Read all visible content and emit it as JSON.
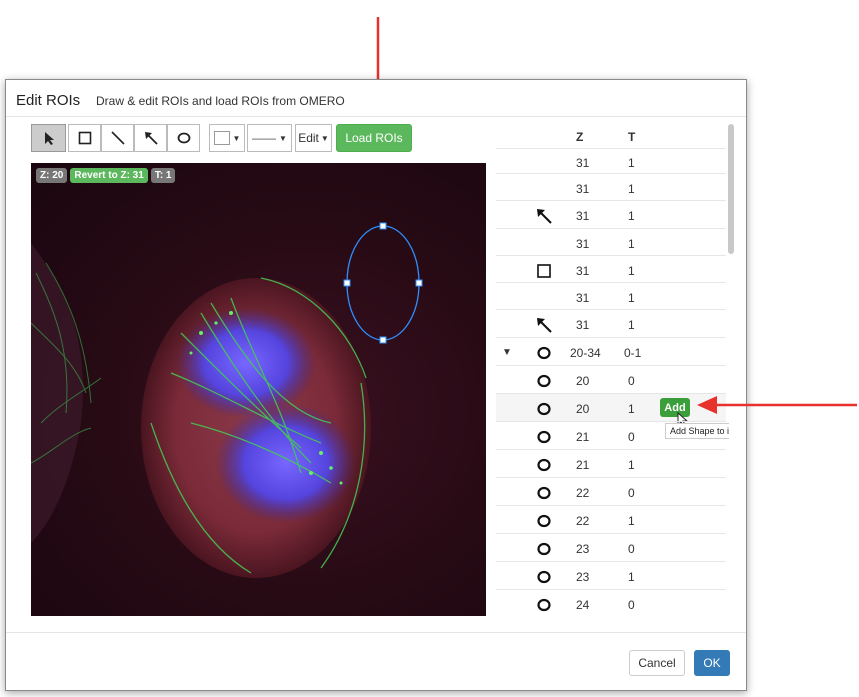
{
  "dialog": {
    "title": "Edit ROIs",
    "subtitle": "Draw & edit ROIs and load ROIs from OMERO"
  },
  "toolbar": {
    "tools": [
      "select-tool-icon",
      "rectangle-tool-icon",
      "line-tool-icon",
      "arrow-tool-icon",
      "ellipse-tool-icon"
    ],
    "line_style": "——",
    "edit_label": "Edit",
    "load_label": "Load ROIs"
  },
  "viewer": {
    "z_badge": "Z: 20",
    "revert_badge": "Revert to Z: 31",
    "t_badge": "T: 1"
  },
  "table": {
    "col_z": "Z",
    "col_t": "T",
    "rows": [
      {
        "icon": "",
        "z": "31",
        "t": "1"
      },
      {
        "icon": "",
        "z": "31",
        "t": "1"
      },
      {
        "icon": "arrow-icon",
        "z": "31",
        "t": "1"
      },
      {
        "icon": "",
        "z": "31",
        "t": "1"
      },
      {
        "icon": "rectangle-icon",
        "z": "31",
        "t": "1"
      },
      {
        "icon": "",
        "z": "31",
        "t": "1"
      },
      {
        "icon": "arrow-icon",
        "z": "31",
        "t": "1"
      },
      {
        "icon": "ellipse-icon",
        "z": "20-34",
        "t": "0-1",
        "expanded": true
      },
      {
        "icon": "ellipse-icon",
        "z": "20",
        "t": "0"
      },
      {
        "icon": "ellipse-icon",
        "z": "20",
        "t": "1"
      },
      {
        "icon": "ellipse-icon",
        "z": "21",
        "t": "0"
      },
      {
        "icon": "ellipse-icon",
        "z": "21",
        "t": "1"
      },
      {
        "icon": "ellipse-icon",
        "z": "22",
        "t": "0"
      },
      {
        "icon": "ellipse-icon",
        "z": "22",
        "t": "1"
      },
      {
        "icon": "ellipse-icon",
        "z": "23",
        "t": "0"
      },
      {
        "icon": "ellipse-icon",
        "z": "23",
        "t": "1"
      },
      {
        "icon": "ellipse-icon",
        "z": "24",
        "t": "0"
      }
    ],
    "add_label": "Add",
    "tooltip": "Add Shape to image"
  },
  "footer": {
    "cancel_label": "Cancel",
    "ok_label": "OK"
  },
  "colors": {
    "green": "#5cb85c",
    "blue": "#337ab7",
    "annotation_arrow": "#e8312a"
  }
}
